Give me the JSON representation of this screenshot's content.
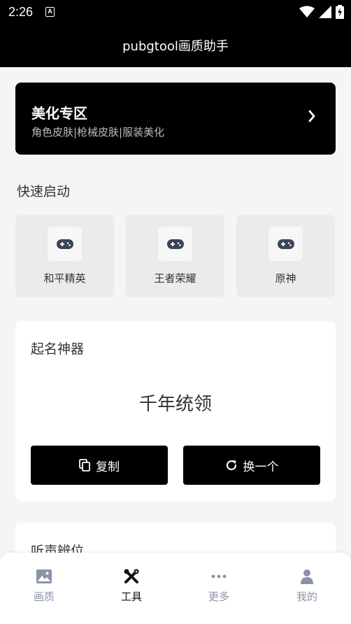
{
  "status_bar": {
    "time": "2:26",
    "notification_glyph": "A",
    "icons": [
      "wifi-icon",
      "signal-icon",
      "battery-charging-icon"
    ]
  },
  "header": {
    "title": "pubgtool画质助手"
  },
  "beauty_zone": {
    "title": "美化专区",
    "subtitle": "角色皮肤|枪械皮肤|服装美化",
    "icon": "chevron-right-icon"
  },
  "quick_launch": {
    "title": "快速启动",
    "games": [
      {
        "label": "和平精英",
        "icon": "gamepad-icon"
      },
      {
        "label": "王者荣耀",
        "icon": "gamepad-icon"
      },
      {
        "label": "原神",
        "icon": "gamepad-icon"
      }
    ]
  },
  "name_generator": {
    "title": "起名神器",
    "result": "千年统领",
    "copy_label": "复制",
    "refresh_label": "换一个"
  },
  "listen_card": {
    "title": "听声辨位"
  },
  "tab_bar": {
    "tabs": [
      {
        "label": "画质",
        "icon": "image-icon",
        "active": false
      },
      {
        "label": "工具",
        "icon": "tools-icon",
        "active": true
      },
      {
        "label": "更多",
        "icon": "more-dots-icon",
        "active": false
      },
      {
        "label": "我的",
        "icon": "user-icon",
        "active": false
      }
    ]
  },
  "colors": {
    "header_bg": "#000000",
    "page_bg": "#f5f5f5",
    "tab_inactive": "#8a93a8",
    "tab_active": "#111111"
  }
}
